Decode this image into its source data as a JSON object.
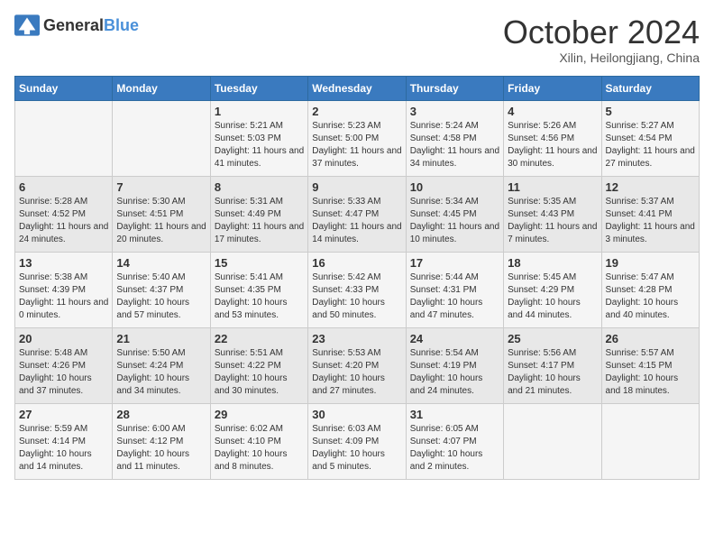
{
  "header": {
    "logo_general": "General",
    "logo_blue": "Blue",
    "month": "October 2024",
    "location": "Xilin, Heilongjiang, China"
  },
  "weekdays": [
    "Sunday",
    "Monday",
    "Tuesday",
    "Wednesday",
    "Thursday",
    "Friday",
    "Saturday"
  ],
  "weeks": [
    [
      {
        "day": "",
        "info": ""
      },
      {
        "day": "",
        "info": ""
      },
      {
        "day": "1",
        "info": "Sunrise: 5:21 AM\nSunset: 5:03 PM\nDaylight: 11 hours and 41 minutes."
      },
      {
        "day": "2",
        "info": "Sunrise: 5:23 AM\nSunset: 5:00 PM\nDaylight: 11 hours and 37 minutes."
      },
      {
        "day": "3",
        "info": "Sunrise: 5:24 AM\nSunset: 4:58 PM\nDaylight: 11 hours and 34 minutes."
      },
      {
        "day": "4",
        "info": "Sunrise: 5:26 AM\nSunset: 4:56 PM\nDaylight: 11 hours and 30 minutes."
      },
      {
        "day": "5",
        "info": "Sunrise: 5:27 AM\nSunset: 4:54 PM\nDaylight: 11 hours and 27 minutes."
      }
    ],
    [
      {
        "day": "6",
        "info": "Sunrise: 5:28 AM\nSunset: 4:52 PM\nDaylight: 11 hours and 24 minutes."
      },
      {
        "day": "7",
        "info": "Sunrise: 5:30 AM\nSunset: 4:51 PM\nDaylight: 11 hours and 20 minutes."
      },
      {
        "day": "8",
        "info": "Sunrise: 5:31 AM\nSunset: 4:49 PM\nDaylight: 11 hours and 17 minutes."
      },
      {
        "day": "9",
        "info": "Sunrise: 5:33 AM\nSunset: 4:47 PM\nDaylight: 11 hours and 14 minutes."
      },
      {
        "day": "10",
        "info": "Sunrise: 5:34 AM\nSunset: 4:45 PM\nDaylight: 11 hours and 10 minutes."
      },
      {
        "day": "11",
        "info": "Sunrise: 5:35 AM\nSunset: 4:43 PM\nDaylight: 11 hours and 7 minutes."
      },
      {
        "day": "12",
        "info": "Sunrise: 5:37 AM\nSunset: 4:41 PM\nDaylight: 11 hours and 3 minutes."
      }
    ],
    [
      {
        "day": "13",
        "info": "Sunrise: 5:38 AM\nSunset: 4:39 PM\nDaylight: 11 hours and 0 minutes."
      },
      {
        "day": "14",
        "info": "Sunrise: 5:40 AM\nSunset: 4:37 PM\nDaylight: 10 hours and 57 minutes."
      },
      {
        "day": "15",
        "info": "Sunrise: 5:41 AM\nSunset: 4:35 PM\nDaylight: 10 hours and 53 minutes."
      },
      {
        "day": "16",
        "info": "Sunrise: 5:42 AM\nSunset: 4:33 PM\nDaylight: 10 hours and 50 minutes."
      },
      {
        "day": "17",
        "info": "Sunrise: 5:44 AM\nSunset: 4:31 PM\nDaylight: 10 hours and 47 minutes."
      },
      {
        "day": "18",
        "info": "Sunrise: 5:45 AM\nSunset: 4:29 PM\nDaylight: 10 hours and 44 minutes."
      },
      {
        "day": "19",
        "info": "Sunrise: 5:47 AM\nSunset: 4:28 PM\nDaylight: 10 hours and 40 minutes."
      }
    ],
    [
      {
        "day": "20",
        "info": "Sunrise: 5:48 AM\nSunset: 4:26 PM\nDaylight: 10 hours and 37 minutes."
      },
      {
        "day": "21",
        "info": "Sunrise: 5:50 AM\nSunset: 4:24 PM\nDaylight: 10 hours and 34 minutes."
      },
      {
        "day": "22",
        "info": "Sunrise: 5:51 AM\nSunset: 4:22 PM\nDaylight: 10 hours and 30 minutes."
      },
      {
        "day": "23",
        "info": "Sunrise: 5:53 AM\nSunset: 4:20 PM\nDaylight: 10 hours and 27 minutes."
      },
      {
        "day": "24",
        "info": "Sunrise: 5:54 AM\nSunset: 4:19 PM\nDaylight: 10 hours and 24 minutes."
      },
      {
        "day": "25",
        "info": "Sunrise: 5:56 AM\nSunset: 4:17 PM\nDaylight: 10 hours and 21 minutes."
      },
      {
        "day": "26",
        "info": "Sunrise: 5:57 AM\nSunset: 4:15 PM\nDaylight: 10 hours and 18 minutes."
      }
    ],
    [
      {
        "day": "27",
        "info": "Sunrise: 5:59 AM\nSunset: 4:14 PM\nDaylight: 10 hours and 14 minutes."
      },
      {
        "day": "28",
        "info": "Sunrise: 6:00 AM\nSunset: 4:12 PM\nDaylight: 10 hours and 11 minutes."
      },
      {
        "day": "29",
        "info": "Sunrise: 6:02 AM\nSunset: 4:10 PM\nDaylight: 10 hours and 8 minutes."
      },
      {
        "day": "30",
        "info": "Sunrise: 6:03 AM\nSunset: 4:09 PM\nDaylight: 10 hours and 5 minutes."
      },
      {
        "day": "31",
        "info": "Sunrise: 6:05 AM\nSunset: 4:07 PM\nDaylight: 10 hours and 2 minutes."
      },
      {
        "day": "",
        "info": ""
      },
      {
        "day": "",
        "info": ""
      }
    ]
  ]
}
